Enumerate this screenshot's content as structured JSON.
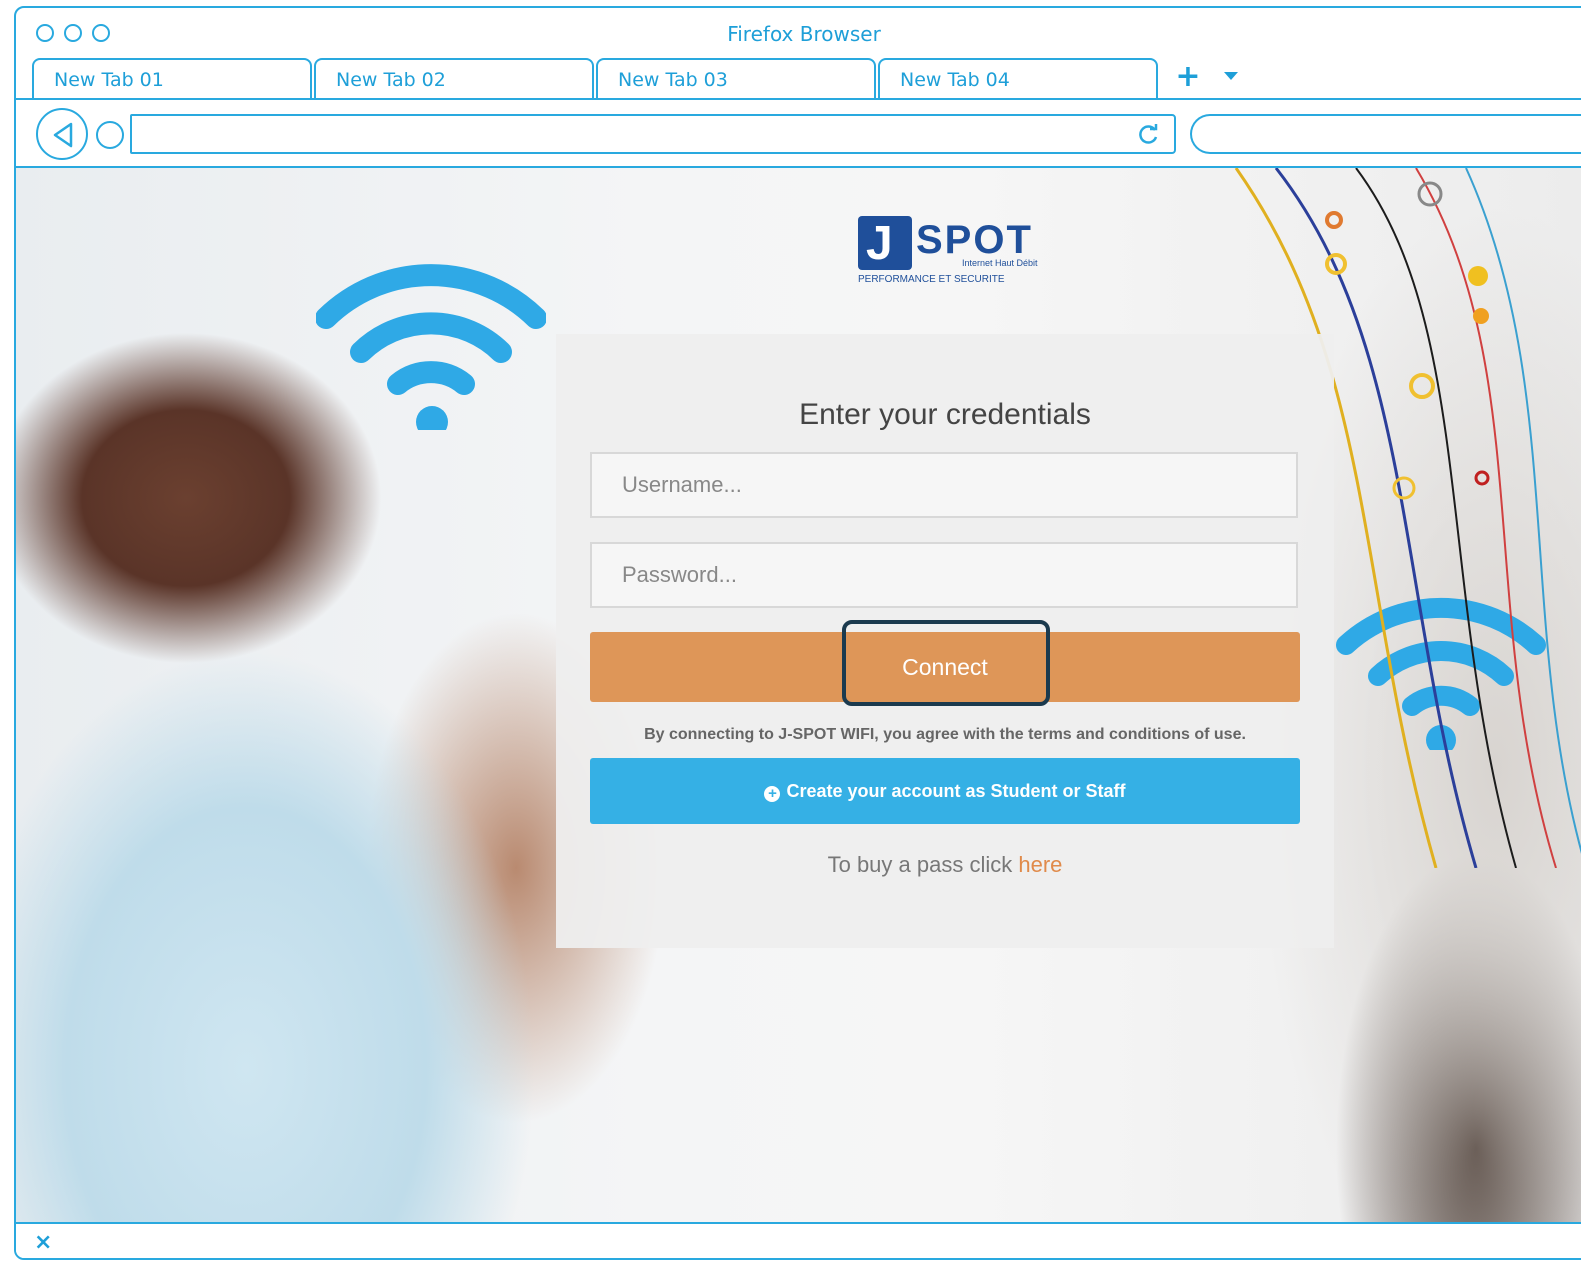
{
  "window": {
    "title": "Firefox Browser"
  },
  "tabs": [
    {
      "label": "New Tab 01"
    },
    {
      "label": "New Tab 02"
    },
    {
      "label": "New Tab 03"
    },
    {
      "label": "New Tab 04"
    }
  ],
  "toolbar": {
    "new_tab": "+",
    "url": "",
    "search": ""
  },
  "brand": {
    "logo_letter": "J",
    "logo_name": "SPOT",
    "tagline_top": "Internet Haut Débit",
    "tagline_bottom": "PERFORMANCE ET SECURITE"
  },
  "login": {
    "title": "Enter your credentials",
    "username_placeholder": "Username...",
    "password_placeholder": "Password...",
    "connect_label": "Connect",
    "terms": "By connecting to J-SPOT WIFI, you agree with the terms and conditions of use.",
    "create_label": "Create your account as Student or Staff",
    "buy_text": "To buy a pass click ",
    "buy_link": "here"
  },
  "statusbar": {
    "close_glyph": "×"
  },
  "colors": {
    "chrome": "#29a9df",
    "connect": "#de9658",
    "create": "#35b0e5",
    "link": "#e08a4a",
    "highlight": "#1b3a4e"
  }
}
